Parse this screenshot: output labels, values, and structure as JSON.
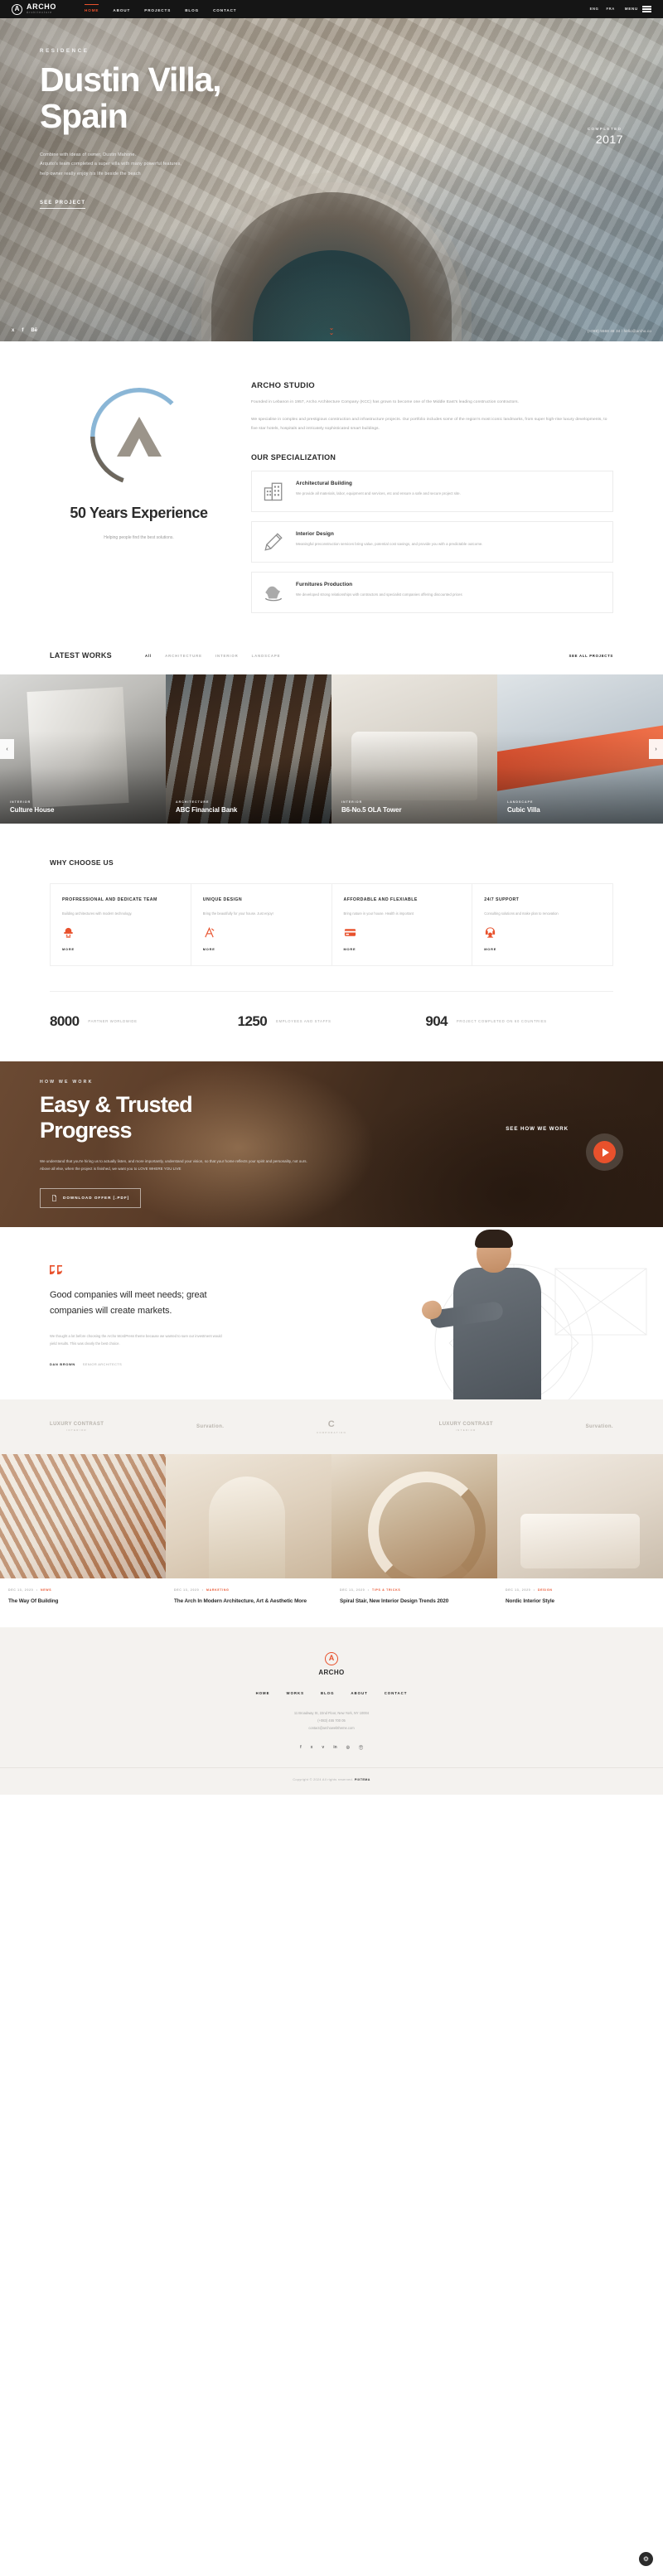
{
  "header": {
    "brand": {
      "name": "ARCHO",
      "tagline": "Architecture",
      "mark": "A"
    },
    "nav": [
      {
        "label": "HOME",
        "active": true
      },
      {
        "label": "ABOUT",
        "active": false
      },
      {
        "label": "PROJECTS",
        "active": false
      },
      {
        "label": "BLOG",
        "active": false
      },
      {
        "label": "CONTACT",
        "active": false
      }
    ],
    "languages": [
      "ENG",
      "FRA"
    ],
    "menu_label": "MENU"
  },
  "hero": {
    "eyebrow": "RESIDENCE",
    "title": "Dustin Villa, Spain",
    "desc_line1": "Combine with ideas of owner, Dustin Mahone.",
    "desc_line2": "Arquito's team completed a super villa with many powerful features,",
    "desc_line3": "help owner really enjoy his life beside the beach",
    "cta": "SEE PROJECT",
    "completed_label": "COMPLETED",
    "completed_year": "2017",
    "socials": [
      "twitter-icon",
      "facebook-icon",
      "behance-icon"
    ],
    "contact": "(+088) 5568 48 34 / hello@archo.co"
  },
  "about": {
    "years_heading": "50 Years Experience",
    "years_sub": "Helping people find the best solutions.",
    "studio_title": "ARCHO STUDIO",
    "studio_p1": "Founded in Lebanon in 1957, Archo Architecture Company (KCC) has grown to become one of the Middle East's leading construction contractors.",
    "studio_p2": "We specialise in complex and prestigious construction and infrastructure projects. Our portfolio includes some of the region's most iconic landmarks, from super high-rise luxury developments, to five star hotels, hospitals and intricately sophisticated smart buildings.",
    "spec_title": "OUR SPECIALIZATION",
    "specializations": [
      {
        "icon": "building-icon",
        "title": "Architectural Building",
        "desc": "We provide all materials, labor, equipment and services, etc and ensure a safe and secure project site."
      },
      {
        "icon": "pencil-icon",
        "title": "Interior Design",
        "desc": "Meaningful preconstruction services bring value, potential cost savings, and provide you with a predictable outcome."
      },
      {
        "icon": "rocking-horse-icon",
        "title": "Furnitures Production",
        "desc": "We developed strong relationships with contractors and specialist companies offering discounted prices"
      }
    ]
  },
  "works": {
    "title": "LATEST WORKS",
    "filters": [
      {
        "label": "All",
        "active": true
      },
      {
        "label": "ARCHITECTURE",
        "active": false
      },
      {
        "label": "INTERIOR",
        "active": false
      },
      {
        "label": "LANDSCAPE",
        "active": false
      }
    ],
    "see_all": "SEE ALL PROJECTS",
    "prev_icon": "chevron-left-icon",
    "next_icon": "chevron-right-icon",
    "items": [
      {
        "category": "INTERIOR",
        "title": "Culture House"
      },
      {
        "category": "ARCHITECTURE",
        "title": "ABC Financial Bank"
      },
      {
        "category": "INTERIOR",
        "title": "B6-No.5 OLA Tower"
      },
      {
        "category": "LANDSCAPE",
        "title": "Cubic Villa"
      }
    ]
  },
  "why": {
    "title": "WHY CHOOSE US",
    "cards": [
      {
        "title": "PROFRESSIONAL AND DEDICATE TEAM",
        "desc": "Building architectures with modern technology.",
        "icon": "worker-helmet-icon",
        "more": "MORE"
      },
      {
        "title": "UNIQUE DESIGN",
        "desc": "Bring the beautifully for your house. Just enjoy!",
        "icon": "drafting-tools-icon",
        "more": "MORE"
      },
      {
        "title": "AFFORDABLE AND FLEXIABLE",
        "desc": "Bring nature in your house. Health is important",
        "icon": "credit-card-icon",
        "more": "MORE"
      },
      {
        "title": "24/7 SUPPORT",
        "desc": "Consulting solutions and make plan to renovation",
        "icon": "headset-support-icon",
        "more": "MORE"
      }
    ],
    "stats": [
      {
        "value": "8000",
        "label": "PARTNER WORLDWIDE"
      },
      {
        "value": "1250",
        "label": "EMPLOYEES AND STAFFS"
      },
      {
        "value": "904",
        "label": "PROJECT COMPLETED ON 60 COUNTRIES"
      }
    ]
  },
  "how": {
    "eyebrow": "HOW WE WORK",
    "title": "Easy & Trusted Progress",
    "desc": "We understand that you're hiring us to actually listen, and more importantly, understand your vision, so that your home reflects your spirit and personality, not ours. Above all else, when the project is finished, we want you to LOVE WHERE YOU LIVE",
    "download": "DOWNLOAD OFFER [.PDF]",
    "download_icon": "file-pdf-icon",
    "see_how": "SEE HOW WE WORK",
    "play_icon": "play-icon"
  },
  "testimonial": {
    "quote_icon": "quote-mark-icon",
    "quote": "Good companies will meet needs; great companies will create markets.",
    "body": "We thought a lot before choosing the Archo WordPress theme because we wanted to sure our investment would yield results. This was clearly the best choice.",
    "author": "DAN BROWN",
    "role": "SENIOR ARCHITECTS"
  },
  "logos": [
    {
      "name": "LUXURY CONTRAST",
      "sub": "INTERIOR"
    },
    {
      "name": "Survation.",
      "sub": ""
    },
    {
      "name": "C",
      "sub": "CORPORATION"
    },
    {
      "name": "LUXURY CONTRAST",
      "sub": "INTERIOR"
    },
    {
      "name": "Survation.",
      "sub": ""
    }
  ],
  "blog": {
    "posts": [
      {
        "date": "DEC 13, 2020",
        "category": "NEWS",
        "title": "The Way Of Building"
      },
      {
        "date": "DEC 13, 2020",
        "category": "MARKETING",
        "title": "The Arch In Modern Architecture, Art & Aesthetic More"
      },
      {
        "date": "DEC 13, 2020",
        "category": "TIPS & TRICKS",
        "title": "Spiral Stair, New Interior Design Trends 2020"
      },
      {
        "date": "DEC 13, 2020",
        "category": "DESIGN",
        "title": "Nordic Interior Style"
      }
    ]
  },
  "footer": {
    "brand_name": "ARCHO",
    "brand_mark": "A",
    "nav": [
      "HOME",
      "WORKS",
      "BLOG",
      "ABOUT",
      "CONTACT"
    ],
    "address": "11 Broadway St, 22nd Floor, New York, NY 10004",
    "phone": "(+083) 455 700 05",
    "email": "contact@archowebtheme.com",
    "socials": [
      "facebook-icon",
      "twitter-icon",
      "vimeo-icon",
      "linkedin-icon",
      "rss-icon",
      "pinterest-icon"
    ],
    "copyright_prefix": "Copyright © 2024 All rights reserved.",
    "copyright_brand": "PIXTEMA",
    "settings_icon": "gear-icon"
  },
  "colors": {
    "accent": "#e8512c",
    "dark": "#151515",
    "muted": "#a8a8a8",
    "panel": "#f4f2ef"
  }
}
